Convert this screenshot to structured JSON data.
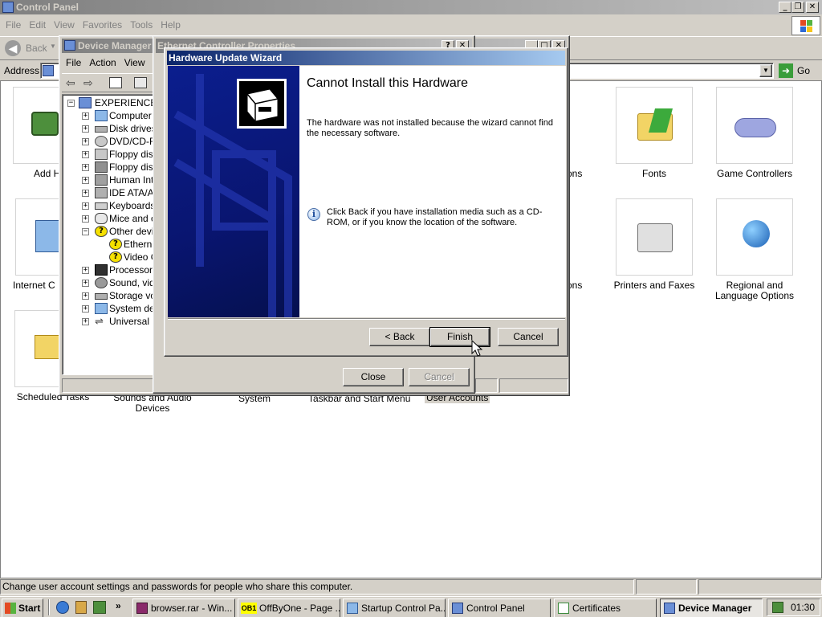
{
  "control_panel": {
    "title": "Control Panel",
    "menu": [
      "File",
      "Edit",
      "View",
      "Favorites",
      "Tools",
      "Help"
    ],
    "back_label": "Back",
    "address_label": "Address",
    "go_label": "Go",
    "items": [
      {
        "label": "Add Har"
      },
      {
        "label": "Fonts"
      },
      {
        "label": "Game Controllers"
      },
      {
        "label": "Internet C"
      },
      {
        "label": "Printers and Faxes"
      },
      {
        "label": "Regional and Language Options"
      },
      {
        "label": "Scheduled Tasks"
      },
      {
        "label": "Sounds and Audio Devices"
      },
      {
        "label": "System"
      },
      {
        "label": "Taskbar and Start Menu"
      },
      {
        "label": "User Accounts"
      },
      {
        "label": "ons"
      },
      {
        "label": "ons"
      }
    ],
    "status_text": "Change user account settings and passwords for people who share this computer."
  },
  "device_manager": {
    "title": "Device Manager",
    "menu": [
      "File",
      "Action",
      "View"
    ],
    "tree": [
      {
        "label": "EXPERIENCE"
      },
      {
        "label": "Computer"
      },
      {
        "label": "Disk drives"
      },
      {
        "label": "DVD/CD-RO"
      },
      {
        "label": "Floppy disk"
      },
      {
        "label": "Floppy disk"
      },
      {
        "label": "Human Inte"
      },
      {
        "label": "IDE ATA/AT"
      },
      {
        "label": "Keyboards"
      },
      {
        "label": "Mice and ot"
      },
      {
        "label": "Other devic"
      },
      {
        "label": "Etherne"
      },
      {
        "label": "Video C"
      },
      {
        "label": "Processors"
      },
      {
        "label": "Sound, vide"
      },
      {
        "label": "Storage vo"
      },
      {
        "label": "System dev"
      },
      {
        "label": "Universal S"
      }
    ]
  },
  "properties": {
    "title": "Ethernet Controller Properties",
    "help_glyph": "?",
    "close_label": "Close",
    "cancel_label": "Cancel"
  },
  "wizard": {
    "title": "Hardware Update Wizard",
    "heading": "Cannot Install this Hardware",
    "body": "The hardware was not installed because the wizard cannot find the necessary software.",
    "info": "Click Back if you have installation media such as a CD-ROM, or if you know the location of the software.",
    "back_label": "< Back",
    "finish_label": "Finish",
    "cancel_label": "Cancel"
  },
  "taskbar": {
    "start_label": "Start",
    "chevron": "»",
    "tasks": [
      {
        "label": "browser.rar - Win..."
      },
      {
        "label": "OffByOne - Page ..."
      },
      {
        "label": "Startup Control Pa..."
      },
      {
        "label": "Control Panel"
      },
      {
        "label": "Certificates"
      },
      {
        "label": "Device Manager"
      }
    ],
    "ob1_badge": "OB1",
    "clock": "01:30"
  },
  "colors": {
    "desktop_gray": "#d4d0c8",
    "active_title": "#0a246a",
    "wizard_banner": "#0a1a7a",
    "warning_yellow": "#f5e000"
  }
}
